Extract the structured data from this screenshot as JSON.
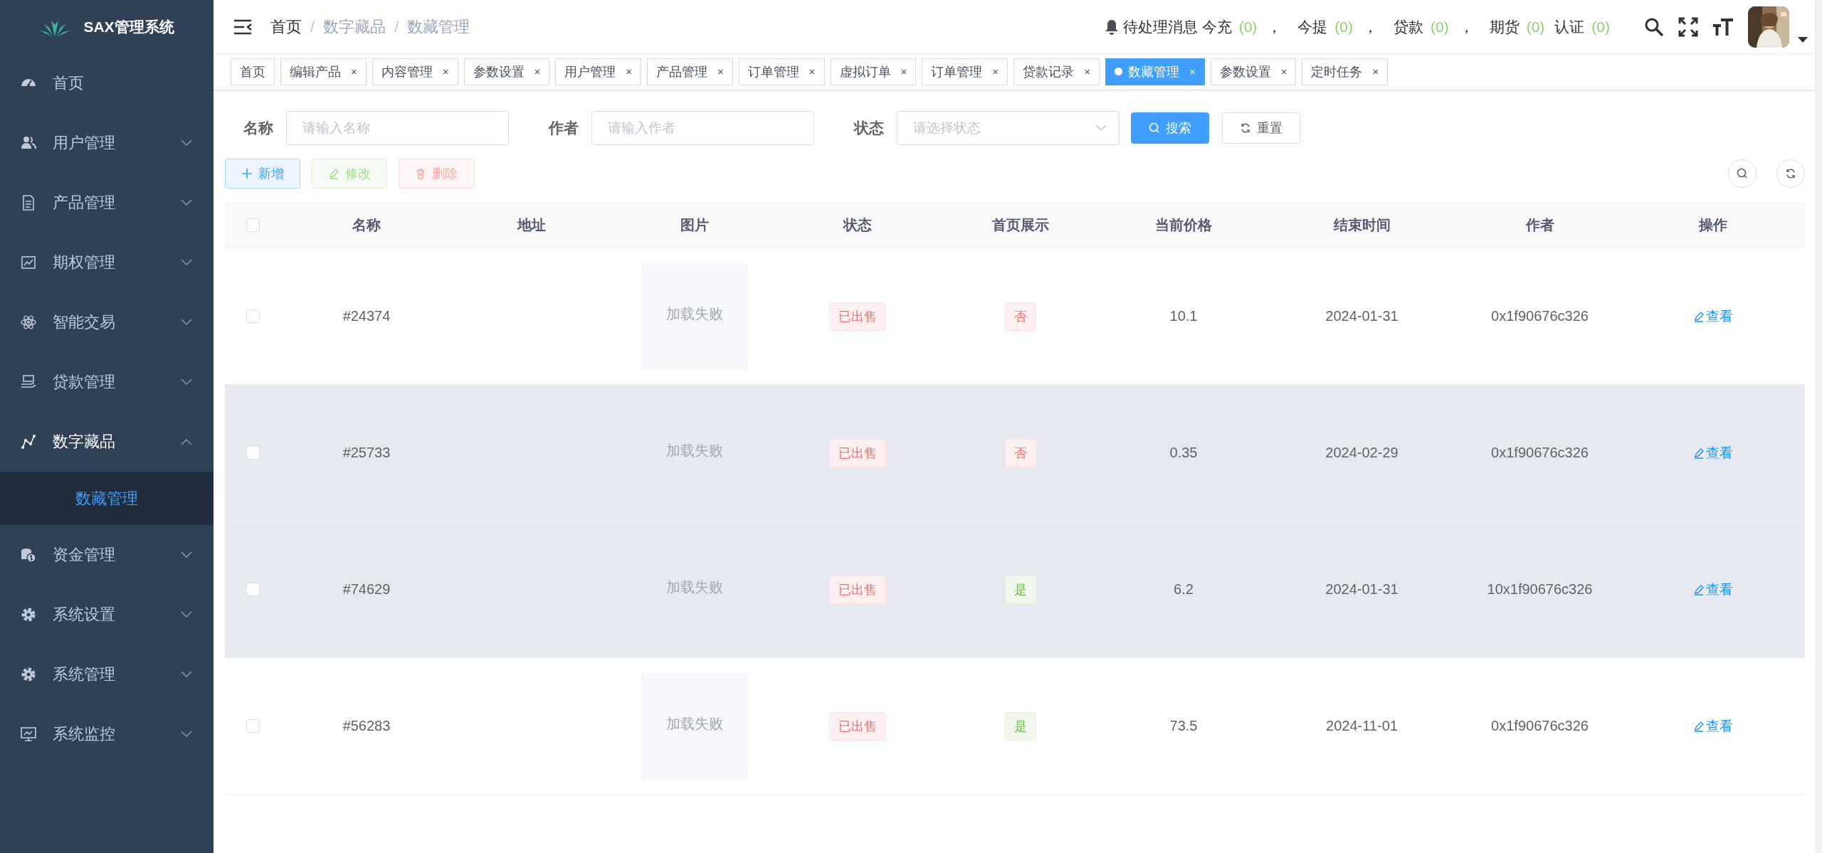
{
  "sidebar": {
    "title": "SAX管理系统",
    "items": [
      {
        "label": "首页"
      },
      {
        "label": "用户管理",
        "expanded": false
      },
      {
        "label": "产品管理",
        "expanded": false
      },
      {
        "label": "期权管理",
        "expanded": false
      },
      {
        "label": "智能交易",
        "expanded": false
      },
      {
        "label": "贷款管理",
        "expanded": false
      },
      {
        "label": "数字藏品",
        "expanded": true,
        "children": [
          {
            "label": "数藏管理",
            "selected": true
          }
        ]
      },
      {
        "label": "资金管理",
        "expanded": false
      },
      {
        "label": "系统设置",
        "expanded": false
      },
      {
        "label": "系统管理",
        "expanded": false
      },
      {
        "label": "系统监控",
        "expanded": false
      }
    ]
  },
  "breadcrumb": [
    "首页",
    "数字藏品",
    "数藏管理"
  ],
  "breadcrumb_separator": "/",
  "notices": [
    {
      "label": "待处理消息 今充",
      "count": "(0)",
      "separator": "，"
    },
    {
      "label": "今提",
      "count": "(0)",
      "separator": "，"
    },
    {
      "label": "贷款",
      "count": "(0)",
      "separator": "，"
    },
    {
      "label": "期货",
      "count": "(0)"
    },
    {
      "label": "认证",
      "count": "(0)"
    }
  ],
  "tabs": [
    {
      "label": "首页",
      "selected": false
    },
    {
      "label": "编辑产品",
      "selected": false,
      "close": "×"
    },
    {
      "label": "内容管理",
      "selected": false,
      "close": "×"
    },
    {
      "label": "参数设置",
      "selected": false,
      "close": "×"
    },
    {
      "label": "用户管理",
      "selected": false,
      "close": "×"
    },
    {
      "label": "产品管理",
      "selected": false,
      "close": "×"
    },
    {
      "label": "订单管理",
      "selected": false,
      "close": "×"
    },
    {
      "label": "虚拟订单",
      "selected": false,
      "close": "×"
    },
    {
      "label": "订单管理",
      "selected": false,
      "close": "×"
    },
    {
      "label": "贷款记录",
      "selected": false,
      "close": "×"
    },
    {
      "label": "数藏管理",
      "selected": true,
      "close": "×"
    },
    {
      "label": "参数设置",
      "selected": false,
      "close": "×"
    },
    {
      "label": "定时任务",
      "selected": false,
      "close": "×"
    }
  ],
  "filters": [
    {
      "kind": "input",
      "label": "名称",
      "placeholder": "请输入名称"
    },
    {
      "kind": "input",
      "label": "作者",
      "placeholder": "请输入作者"
    },
    {
      "kind": "select",
      "label": "状态",
      "placeholder": "请选择状态"
    }
  ],
  "filter_buttons": [
    {
      "kind": "primary",
      "label": "搜索"
    },
    {
      "kind": "plain",
      "label": "重置"
    }
  ],
  "actions": [
    {
      "kind": "primary",
      "label": "新增",
      "disabled": false
    },
    {
      "kind": "success",
      "label": "修改",
      "disabled": true
    },
    {
      "kind": "danger",
      "label": "删除",
      "disabled": true
    }
  ],
  "table": {
    "select_all": false,
    "columns": [
      "名称",
      "地址",
      "图片",
      "状态",
      "首页展示",
      "当前价格",
      "结束时间",
      "作者",
      "操作"
    ],
    "rows": [
      {
        "checked": false,
        "highlighted": false,
        "name": "#24374",
        "image": "加载失败",
        "status": "已出售",
        "featured": false,
        "featured_label": "否",
        "price": "10.1",
        "end": "2024-01-31",
        "author": "0x1f90676c326",
        "action": "查看"
      },
      {
        "checked": false,
        "highlighted": true,
        "name": "#25733",
        "image": "加载失败",
        "status": "已出售",
        "featured": false,
        "featured_label": "否",
        "price": "0.35",
        "end": "2024-02-29",
        "author": "0x1f90676c326",
        "action": "查看"
      },
      {
        "checked": false,
        "highlighted": true,
        "name": "#74629",
        "image": "加载失败",
        "status": "已出售",
        "featured": true,
        "featured_label": "是",
        "price": "6.2",
        "end": "2024-01-31",
        "author": "10x1f90676c326",
        "action": "查看"
      },
      {
        "checked": false,
        "highlighted": false,
        "name": "#56283",
        "image": "加载失败",
        "status": "已出售",
        "featured": true,
        "featured_label": "是",
        "price": "73.5",
        "end": "2024-11-01",
        "author": "0x1f90676c326",
        "action": "查看"
      }
    ]
  }
}
